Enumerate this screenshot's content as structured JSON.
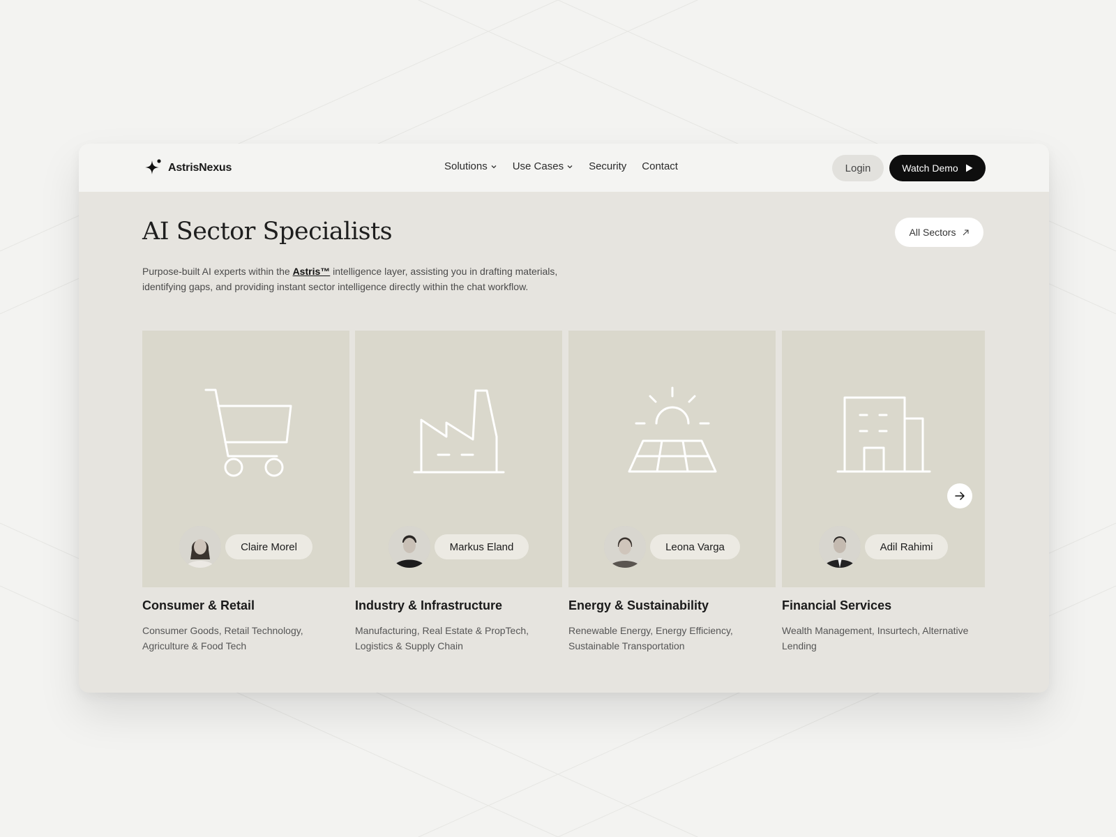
{
  "brand": {
    "name": "AstrisNexus",
    "icon": "sparkle-logo-icon"
  },
  "nav": {
    "items": [
      {
        "label": "Solutions",
        "has_dropdown": true
      },
      {
        "label": "Use Cases",
        "has_dropdown": true
      },
      {
        "label": "Security",
        "has_dropdown": false
      },
      {
        "label": "Contact",
        "has_dropdown": false
      }
    ],
    "login_label": "Login",
    "demo_label": "Watch Demo"
  },
  "hero": {
    "title": "AI Sector Specialists",
    "all_sectors_label": "All Sectors",
    "desc_before": "Purpose-built AI experts within the ",
    "desc_link": "Astris™",
    "desc_after": " intelligence layer, assisting you in drafting materials, identifying gaps, and providing instant sector intelligence directly within the chat workflow."
  },
  "sectors": [
    {
      "title": "Consumer & Retail",
      "subtitle": "Consumer Goods, Retail Technology, Agriculture & Food Tech",
      "specialist": "Claire Morel",
      "icon": "shopping-cart-icon"
    },
    {
      "title": "Industry & Infrastructure",
      "subtitle": "Manufacturing, Real Estate & PropTech, Logistics & Supply Chain",
      "specialist": "Markus Eland",
      "icon": "factory-icon"
    },
    {
      "title": "Energy & Sustainability",
      "subtitle": "Renewable Energy, Energy Efficiency, Sustainable Transportation",
      "specialist": "Leona Varga",
      "icon": "solar-panel-icon"
    },
    {
      "title": "Financial Services",
      "subtitle": "Wealth Management, Insurtech, Alternative Lending",
      "specialist": "Adil Rahimi",
      "icon": "office-building-icon"
    }
  ],
  "colors": {
    "card_bg": "#dad8cc",
    "page_bg": "#e6e4df",
    "nav_bg": "#f4f4f2",
    "accent_dark": "#0e0e0e"
  }
}
